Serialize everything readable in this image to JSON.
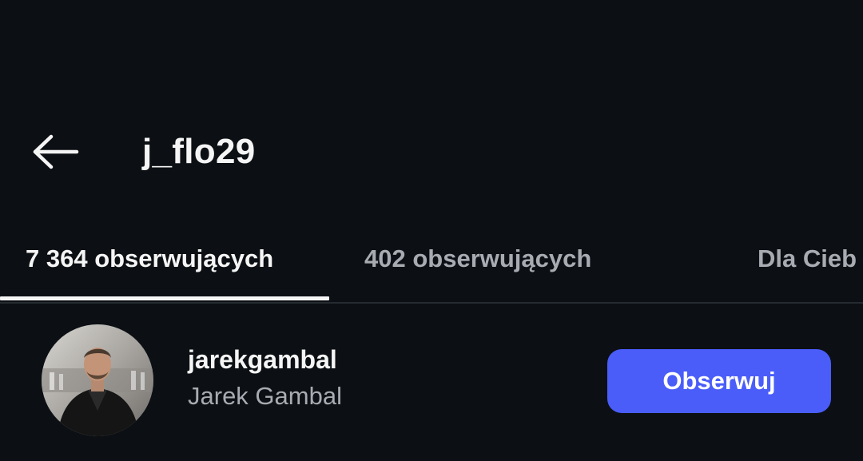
{
  "header": {
    "back_icon": "arrow-left-icon",
    "title": "j_flo29"
  },
  "tabs": [
    {
      "label": "7 364 obserwujących",
      "active": true
    },
    {
      "label": "402 obserwujących",
      "active": false
    },
    {
      "label": "Dla Cieb",
      "active": false
    }
  ],
  "list": {
    "items": [
      {
        "username": "jarekgambal",
        "full_name": "Jarek Gambal",
        "button_label": "Obserwuj"
      }
    ]
  },
  "colors": {
    "background": "#0c1014",
    "primary_text": "#f5f5f5",
    "secondary_text": "#a8abb1",
    "accent_button": "#4a5df9",
    "divider": "#262b31"
  }
}
